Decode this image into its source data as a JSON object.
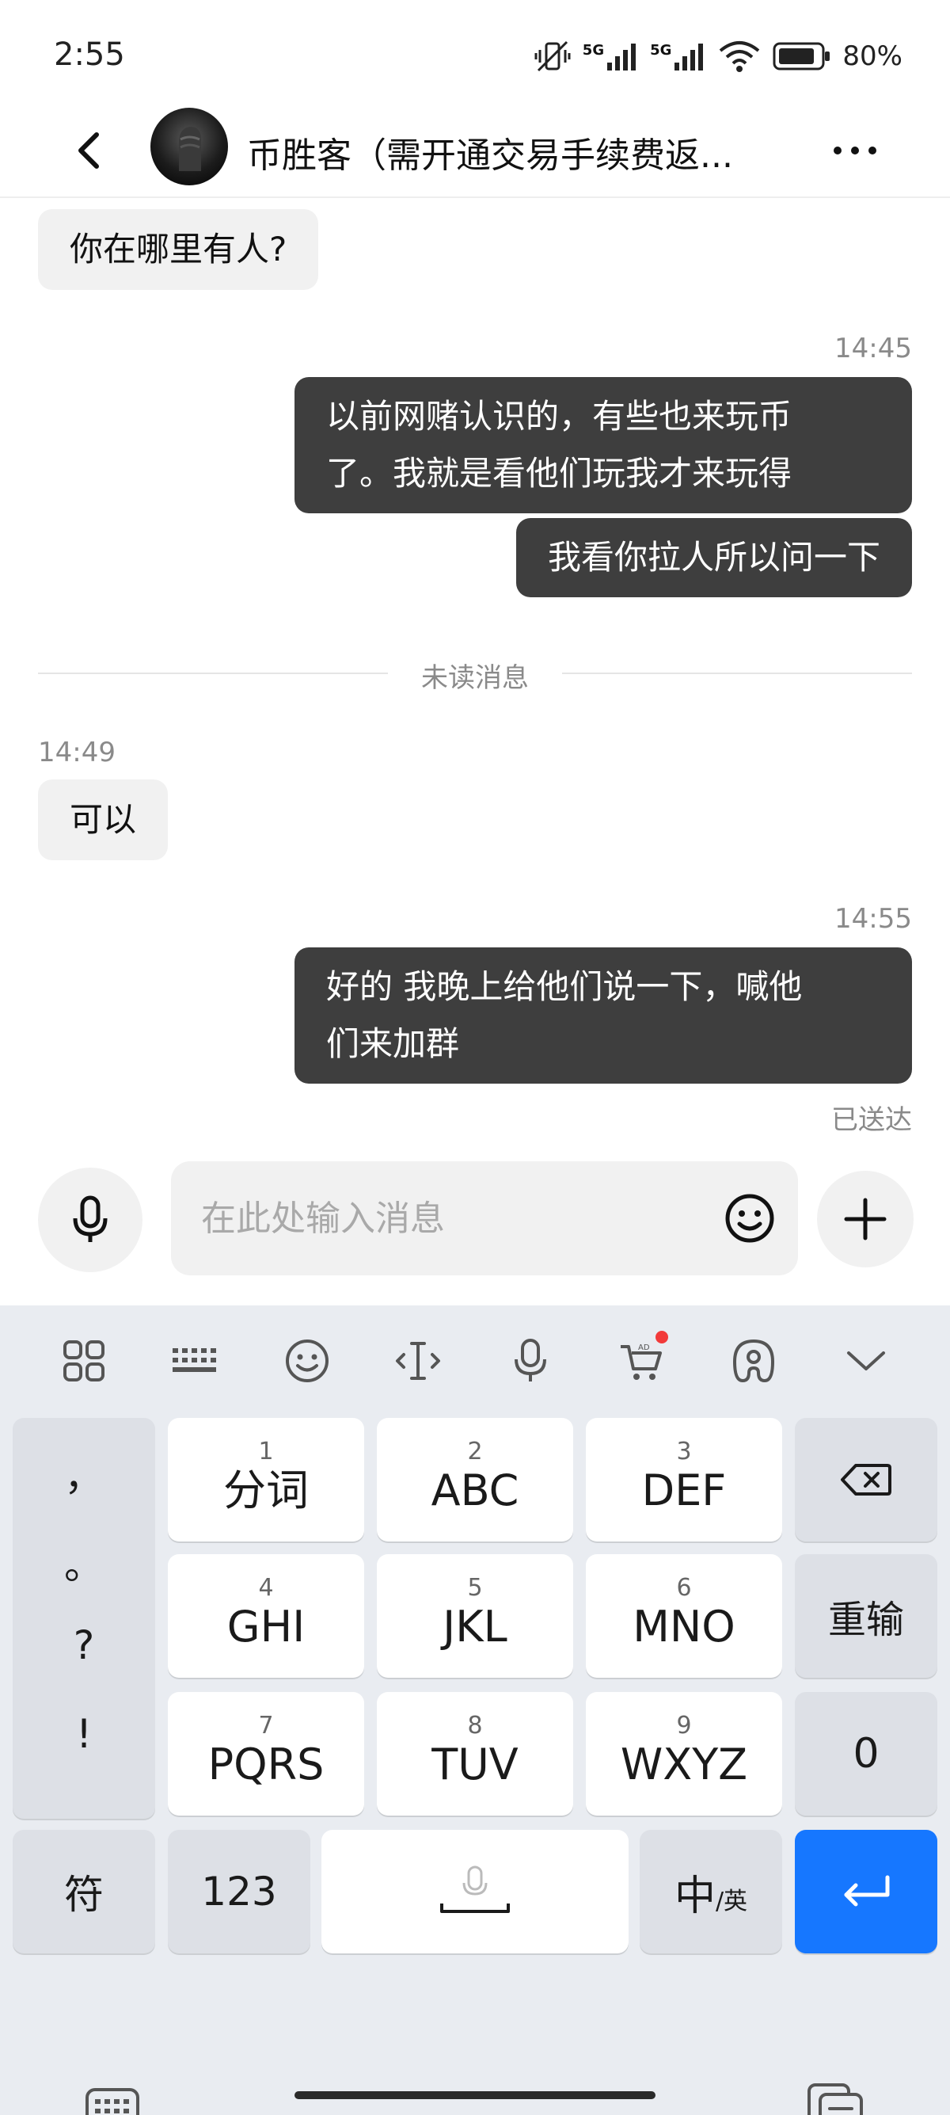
{
  "status_bar": {
    "time": "2:55",
    "battery": "80%",
    "network_1": "5G",
    "network_2": "5G"
  },
  "header": {
    "back_icon": "chevron-left-icon",
    "title": "币胜客（需开通交易手续费返...",
    "more_icon": "more-dots-icon"
  },
  "messages": [
    {
      "side": "in",
      "text": "你在哪里有人?"
    },
    {
      "timestamp": "14:45"
    },
    {
      "side": "out",
      "text_lines": [
        "以前网赌认识的，有些也来玩币",
        "了。我就是看他们玩我才来玩得"
      ]
    },
    {
      "side": "out",
      "text": "我看你拉人所以问一下"
    },
    {
      "divider": "未读消息"
    },
    {
      "timestamp": "14:49"
    },
    {
      "side": "in",
      "text": "可以"
    },
    {
      "timestamp": "14:55"
    },
    {
      "side": "out",
      "text_lines": [
        "好的 我晚上给他们说一下，喊他",
        "们来加群"
      ]
    }
  ],
  "delivered_status": "已送达",
  "composer": {
    "placeholder": "在此处输入消息",
    "voice_icon": "microphone-icon",
    "emoji_icon": "smiley-icon",
    "plus_icon": "plus-icon"
  },
  "keyboard": {
    "toolbar_icons": [
      "apps-grid-icon",
      "keyboard-layout-icon",
      "emoji-icon",
      "cursor-move-icon",
      "voice-input-icon",
      "shop-cart-icon",
      "skin-theme-icon",
      "collapse-chevron-icon"
    ],
    "punctuation": [
      "，",
      "。",
      "?",
      "!"
    ],
    "keys": [
      {
        "num": "1",
        "label": "分词"
      },
      {
        "num": "2",
        "label": "ABC"
      },
      {
        "num": "3",
        "label": "DEF"
      },
      {
        "num": "4",
        "label": "GHI"
      },
      {
        "num": "5",
        "label": "JKL"
      },
      {
        "num": "6",
        "label": "MNO"
      },
      {
        "num": "7",
        "label": "PQRS"
      },
      {
        "num": "8",
        "label": "TUV"
      },
      {
        "num": "9",
        "label": "WXYZ"
      }
    ],
    "reenter": "重输",
    "zero": "0",
    "symbols": "符",
    "numbers": "123",
    "lang_main": "中",
    "lang_sub": "/英",
    "nav_left_icon": "keyboard-toggle-icon",
    "nav_right_icon": "clipboard-icon"
  },
  "colors": {
    "outgoing_bubble": "#3e3e3e",
    "incoming_bubble": "#f1f1f1",
    "enter_key": "#1677ff",
    "keyboard_bg": "#e9ecf1"
  }
}
